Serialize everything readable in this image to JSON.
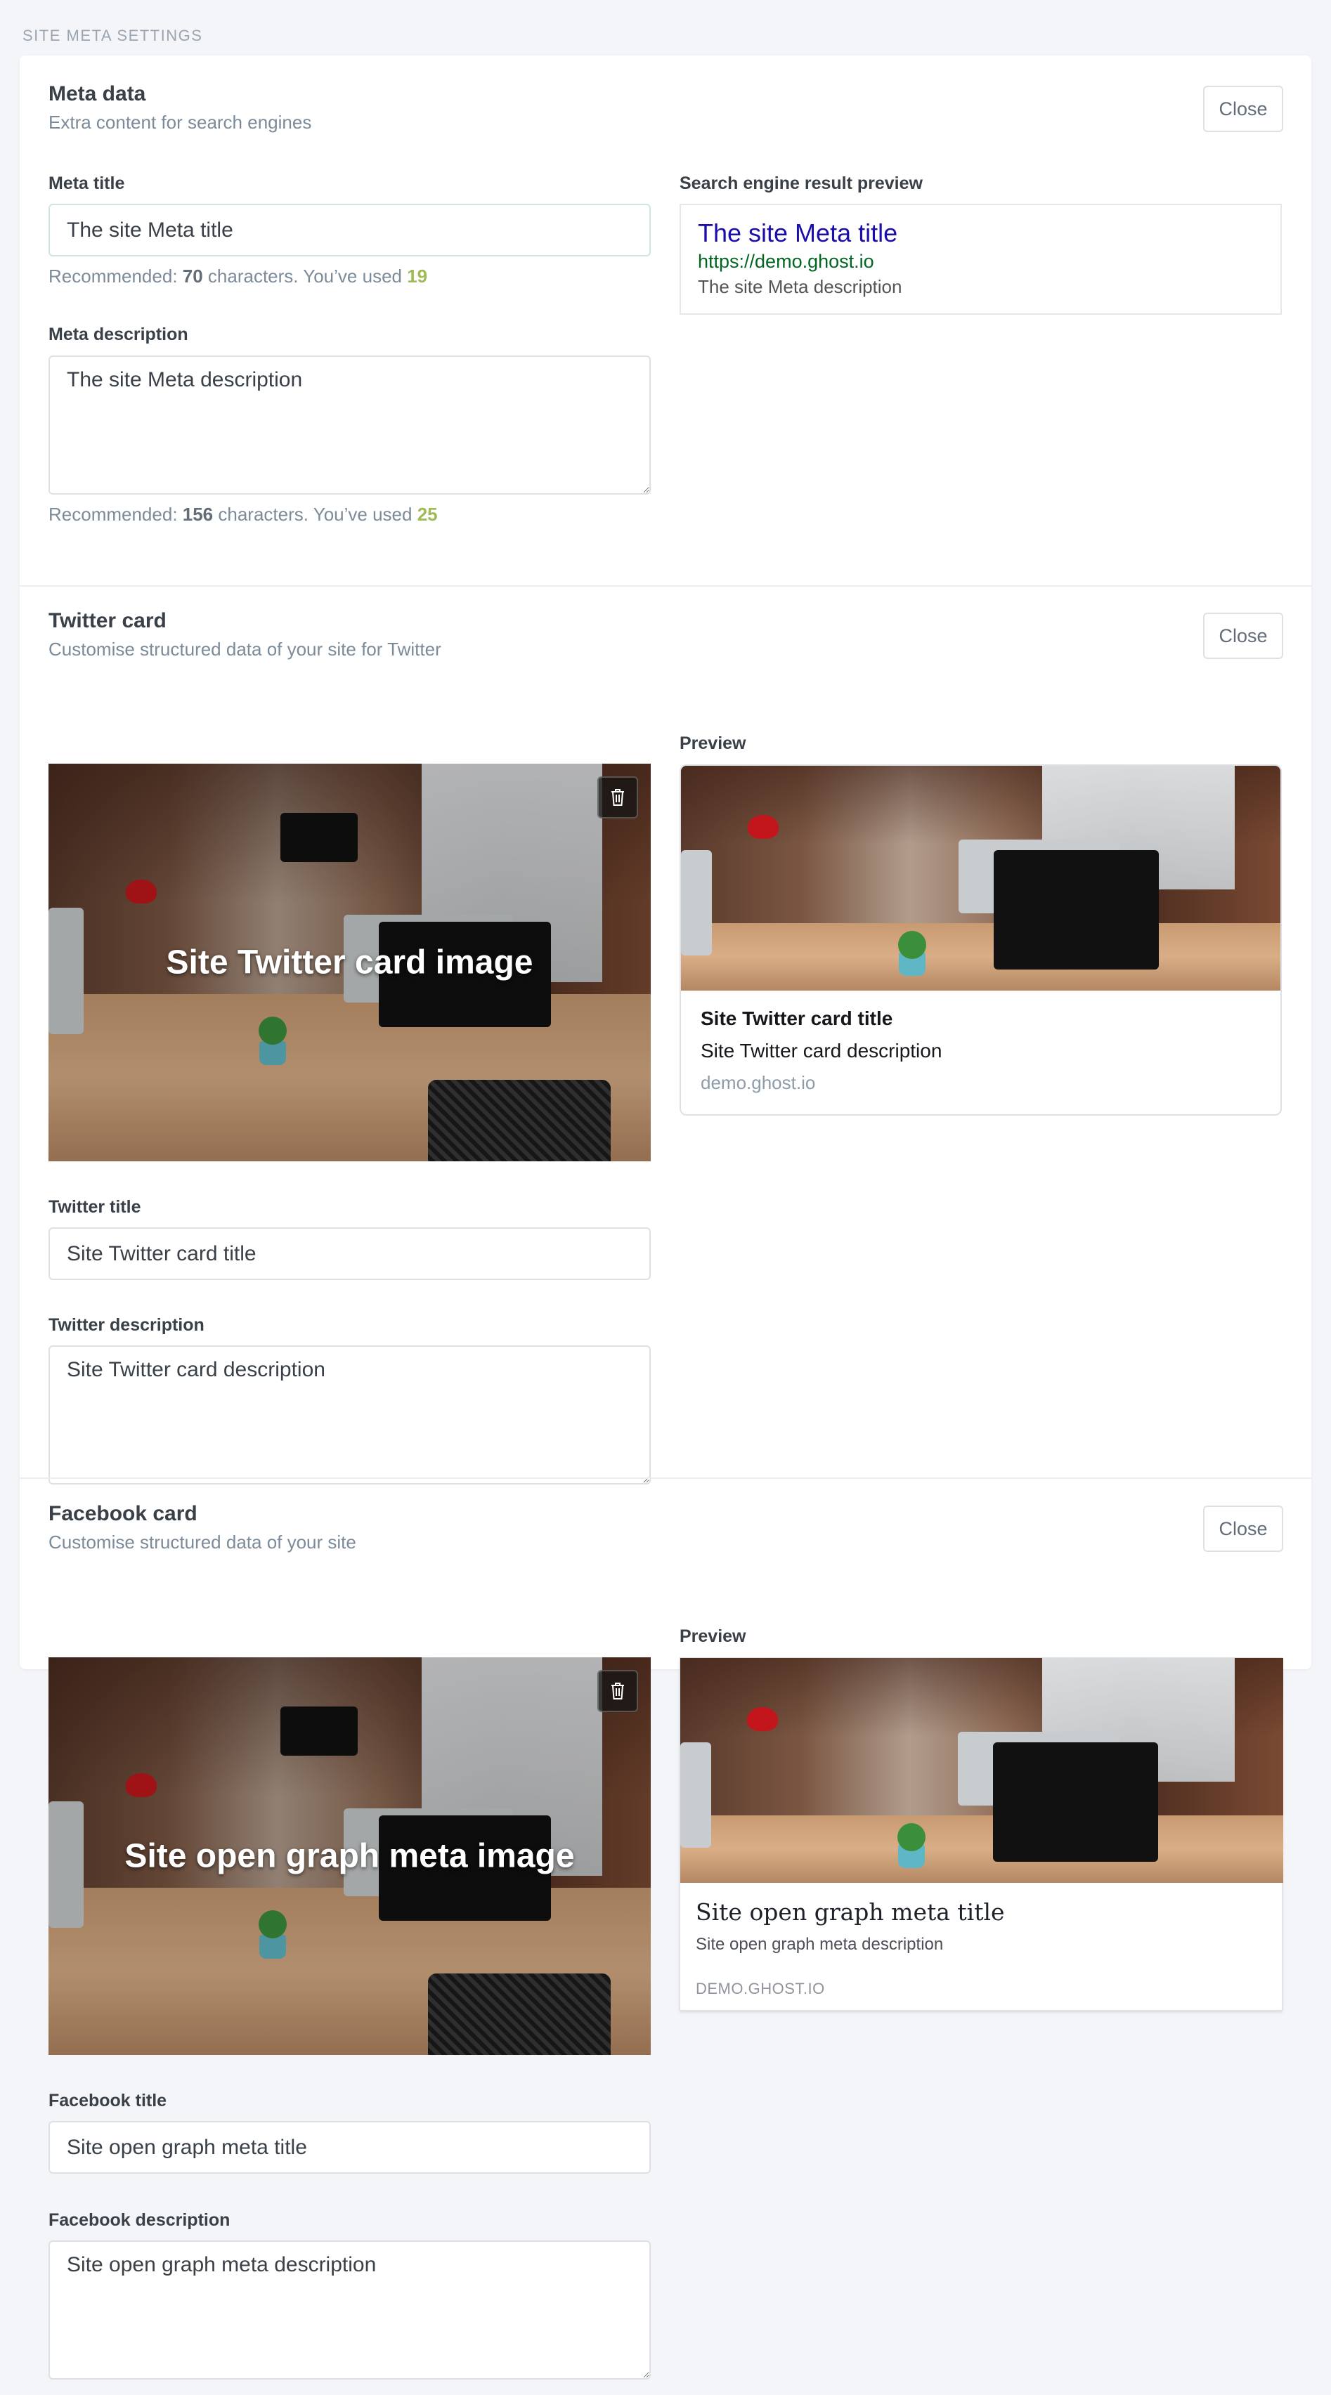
{
  "page": {
    "section_label": "SITE META SETTINGS"
  },
  "meta": {
    "title": "Meta data",
    "subtitle": "Extra content for search engines",
    "close_label": "Close",
    "meta_title_label": "Meta title",
    "meta_title_value": "The site Meta title",
    "meta_title_hint_prefix": "Recommended: ",
    "meta_title_recommended": "70",
    "meta_title_hint_mid": " characters. You’ve used ",
    "meta_title_used": "19",
    "meta_desc_label": "Meta description",
    "meta_desc_value": "The site Meta description",
    "meta_desc_hint_prefix": "Recommended: ",
    "meta_desc_recommended": "156",
    "meta_desc_hint_mid": " characters. You’ve used ",
    "meta_desc_used": "25",
    "serp_label": "Search engine result preview",
    "serp_title": "The site Meta title",
    "serp_url": "https://demo.ghost.io",
    "serp_desc": "The site Meta description"
  },
  "twitter": {
    "title": "Twitter card",
    "subtitle": "Customise structured data of your site for Twitter",
    "close_label": "Close",
    "image_overlay": "Site Twitter card image",
    "preview_label": "Preview",
    "preview_title": "Site Twitter card title",
    "preview_desc": "Site Twitter card description",
    "preview_domain": "demo.ghost.io",
    "title_label": "Twitter title",
    "title_value": "Site Twitter card title",
    "desc_label": "Twitter description",
    "desc_value": "Site Twitter card description"
  },
  "facebook": {
    "title": "Facebook card",
    "subtitle": "Customise structured data of your site",
    "close_label": "Close",
    "image_overlay": "Site open graph meta image",
    "preview_label": "Preview",
    "preview_title": "Site open graph meta title",
    "preview_desc": "Site open graph meta description",
    "preview_domain": "DEMO.GHOST.IO",
    "title_label": "Facebook title",
    "title_value": "Site open graph meta title",
    "desc_label": "Facebook description",
    "desc_value": "Site open graph meta description"
  },
  "icons": {
    "delete": "trash-icon"
  },
  "colors": {
    "serp_title": "#1a0dab",
    "serp_url": "#006621",
    "used_count": "#9fbb58"
  }
}
